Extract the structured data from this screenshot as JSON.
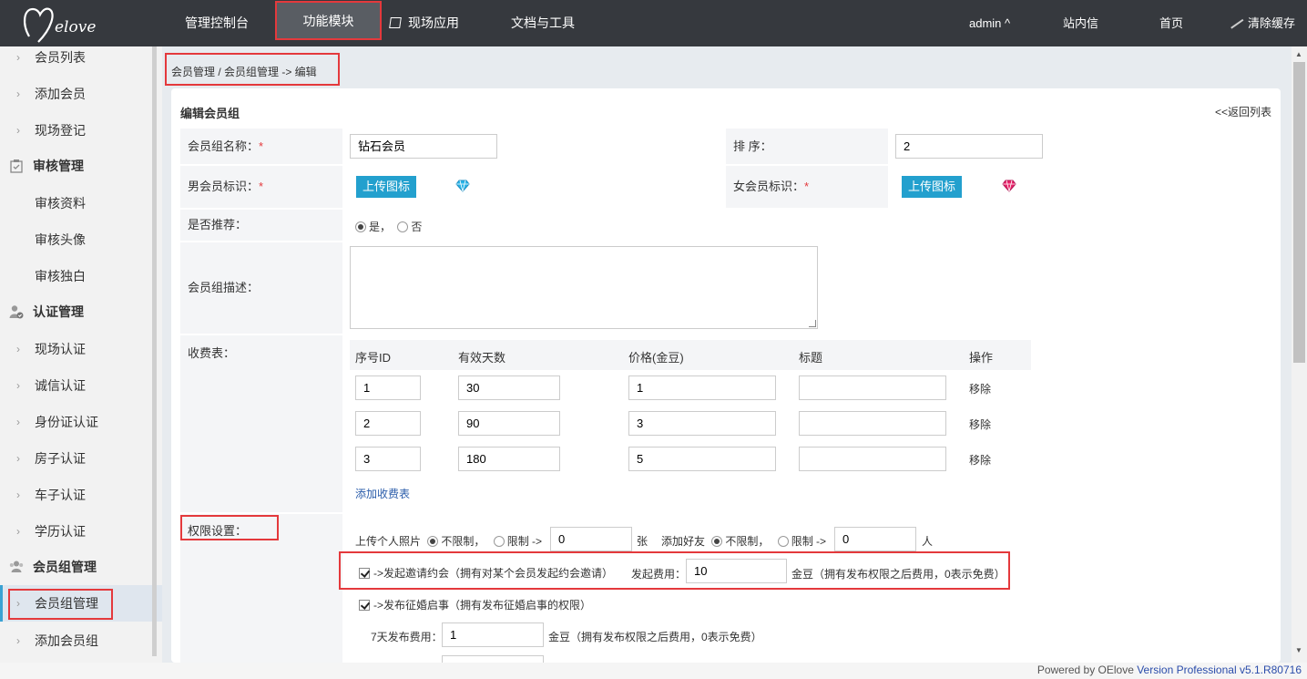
{
  "nav": {
    "items": [
      "管理控制台",
      "功能模块",
      "现场应用",
      "文档与工具"
    ],
    "user": "admin ^",
    "messages": "站内信",
    "home": "首页",
    "clear_cache": "清除缓存"
  },
  "sidebar": {
    "items": [
      "会员列表",
      "添加会员",
      "现场登记",
      "审核管理",
      "审核资料",
      "审核头像",
      "审核独白",
      "认证管理",
      "现场认证",
      "诚信认证",
      "身份证认证",
      "房子认证",
      "车子认证",
      "学历认证",
      "会员组管理",
      "会员组管理",
      "添加会员组"
    ]
  },
  "breadcrumb": "会员管理 / 会员组管理 -> 编辑",
  "form": {
    "title": "编辑会员组",
    "back": "<<返回列表",
    "name_label": "会员组名称：",
    "req": "*",
    "name_value": "钻石会员",
    "sort_label": "排 序：",
    "sort_value": "2",
    "male_label": "男会员标识：",
    "female_label": "女会员标识：",
    "upload_btn": "上传图标",
    "recommend_label": "是否推荐：",
    "yes": "是，",
    "no": "否",
    "desc_label": "会员组描述：",
    "fee_label": "收费表：",
    "fee_headers": [
      "序号ID",
      "有效天数",
      "价格(金豆)",
      "标题",
      "操作"
    ],
    "fee_rows": [
      {
        "id": "1",
        "days": "30",
        "price": "1",
        "title": "",
        "op": "移除"
      },
      {
        "id": "2",
        "days": "90",
        "price": "3",
        "title": "",
        "op": "移除"
      },
      {
        "id": "3",
        "days": "180",
        "price": "5",
        "title": "",
        "op": "移除"
      }
    ],
    "add_fee": "添加收费表",
    "perm_label": "权限设置：",
    "photo_label": "上传个人照片",
    "unlimited": "不限制，",
    "limited": "限制 ->",
    "photo_limit": "0",
    "photo_unit": "张",
    "friend_label": "添加好友",
    "friend_limit": "0",
    "friend_unit": "人",
    "invite_label": "->发起邀请约会（拥有对某个会员发起约会邀请）",
    "invite_fee_label": "发起费用：",
    "invite_fee": "10",
    "invite_fee_note": "金豆（拥有发布权限之后费用，0表示免费）",
    "marriage_label": "->发布征婚启事（拥有发布征婚启事的权限）",
    "seven_day_label": "7天发布费用：",
    "seven_day_fee": "1",
    "seven_day_note": "金豆（拥有发布权限之后费用，0表示免费）"
  },
  "footer": {
    "powered": "Powered by OElove ",
    "version": "Version Professional v5.1.R80716"
  },
  "colors": {
    "topbar": "#36393e",
    "accent": "#23a0ce",
    "highlight": "#e4393c"
  }
}
